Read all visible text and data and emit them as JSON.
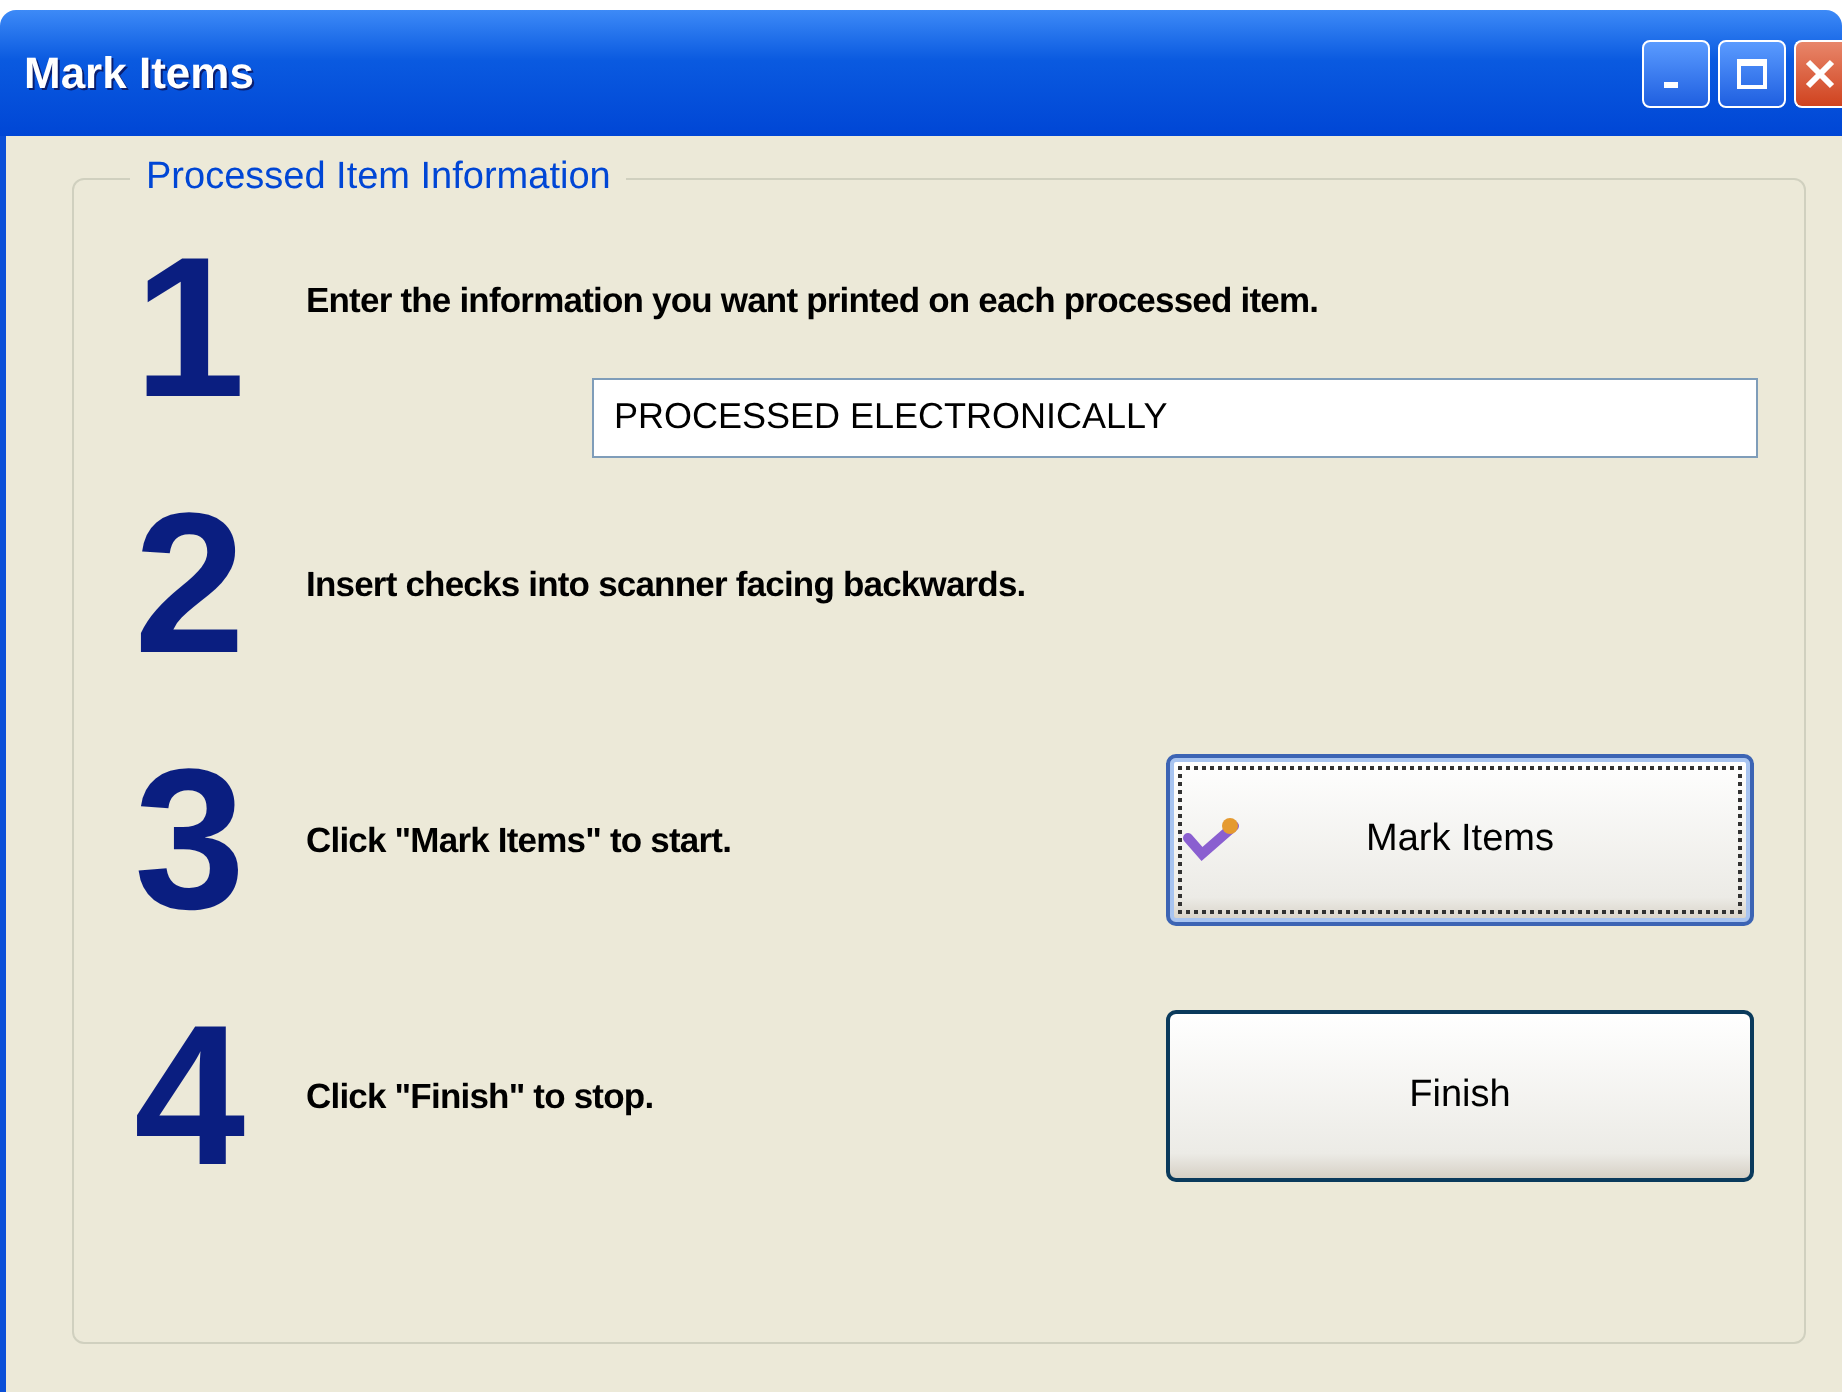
{
  "window": {
    "title": "Mark Items"
  },
  "group": {
    "legend": "Processed Item Information"
  },
  "steps": [
    {
      "number": "1",
      "text": "Enter the information you want printed on each processed item.",
      "kind": "input",
      "field": {
        "value": "PROCESSED ELECTRONICALLY"
      }
    },
    {
      "number": "2",
      "text": "Insert checks into scanner facing backwards.",
      "kind": "none"
    },
    {
      "number": "3",
      "text": "Click \"Mark Items\" to start.",
      "kind": "button",
      "button": {
        "label": "Mark Items",
        "focused": true,
        "icon": true
      }
    },
    {
      "number": "4",
      "text": "Click \"Finish\" to stop.",
      "kind": "button",
      "button": {
        "label": "Finish",
        "focused": false,
        "icon": false
      }
    }
  ]
}
